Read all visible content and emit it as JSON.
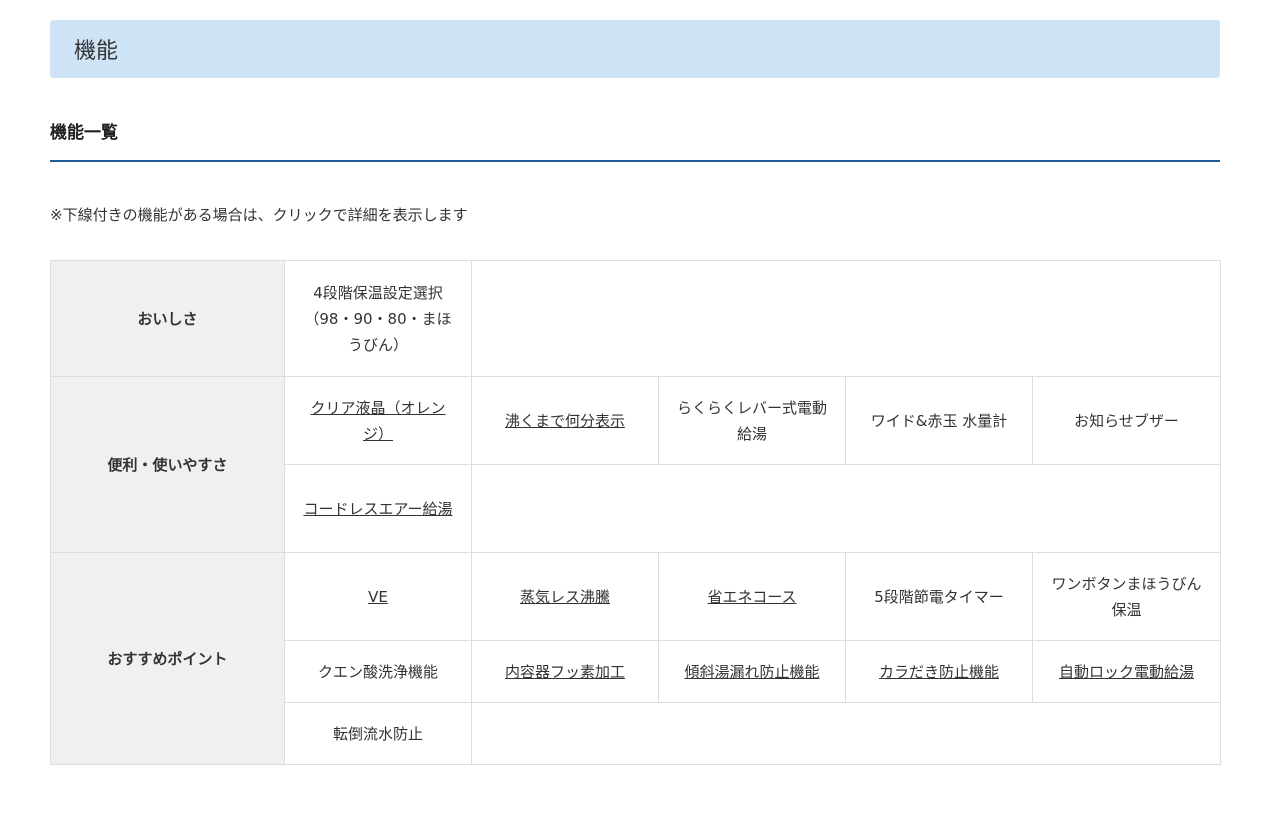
{
  "header": {
    "title": "機能"
  },
  "section": {
    "title": "機能一覧"
  },
  "note": "※下線付きの機能がある場合は、クリックで詳細を表示します",
  "categories": [
    {
      "label": "おいしさ",
      "rows": [
        [
          {
            "text": "4段階保温設定選択（98・90・80・まほうびん）",
            "link": false
          }
        ]
      ]
    },
    {
      "label": "便利・使いやすさ",
      "rows": [
        [
          {
            "text": "クリア液晶（オレンジ）",
            "link": true
          },
          {
            "text": "沸くまで何分表示",
            "link": true
          },
          {
            "text": "らくらくレバー式電動給湯",
            "link": false
          },
          {
            "text": "ワイド&赤玉 水量計",
            "link": false
          },
          {
            "text": "お知らせブザー",
            "link": false
          }
        ],
        [
          {
            "text": "コードレスエアー給湯",
            "link": true
          }
        ]
      ]
    },
    {
      "label": "おすすめポイント",
      "rows": [
        [
          {
            "text": "VE",
            "link": true
          },
          {
            "text": "蒸気レス沸騰",
            "link": true
          },
          {
            "text": "省エネコース",
            "link": true
          },
          {
            "text": "5段階節電タイマー",
            "link": false
          },
          {
            "text": "ワンボタンまほうびん保温",
            "link": false
          }
        ],
        [
          {
            "text": "クエン酸洗浄機能",
            "link": false
          },
          {
            "text": "内容器フッ素加工",
            "link": true
          },
          {
            "text": "傾斜湯漏れ防止機能",
            "link": true
          },
          {
            "text": "カラだき防止機能",
            "link": true
          },
          {
            "text": "自動ロック電動給湯",
            "link": true
          }
        ],
        [
          {
            "text": "転倒流水防止",
            "link": false
          }
        ]
      ]
    }
  ],
  "colors": {
    "banner_bg": "#cfe3f7",
    "rule": "#1e5a96",
    "category_bg": "#f0f0f0",
    "border": "#dddddd"
  }
}
